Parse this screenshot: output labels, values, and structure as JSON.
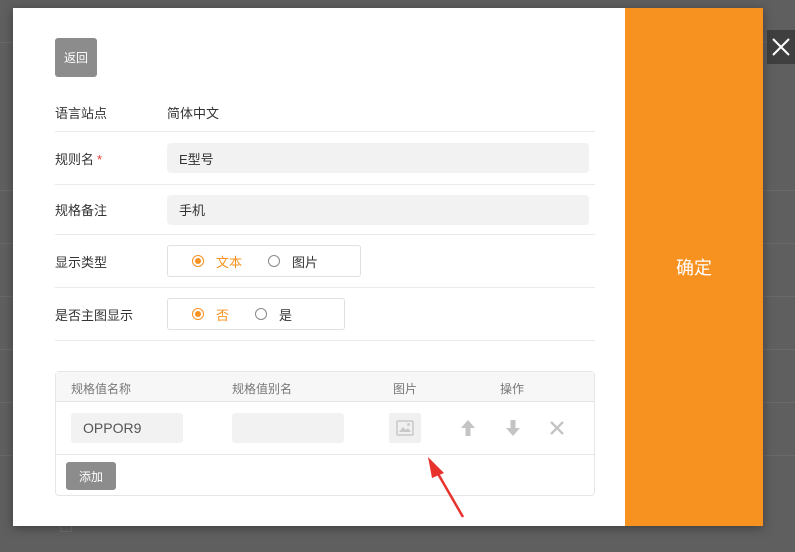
{
  "form": {
    "back_label": "返回",
    "language_label": "语言站点",
    "language_value": "简体中文",
    "rule_label": "规则名",
    "required_mark": "*",
    "rule_value": "E型号",
    "note_label": "规格备注",
    "note_value": "手机",
    "display_type_label": "显示类型",
    "display_type_options": [
      "文本",
      "图片"
    ],
    "display_type_selected": "文本",
    "main_image_label": "是否主图显示",
    "main_image_options": [
      "否",
      "是"
    ],
    "main_image_selected": "否"
  },
  "table": {
    "headers": [
      "规格值名称",
      "规格值别名",
      "图片",
      "操作"
    ],
    "rows": [
      {
        "name": "OPPOR9",
        "alias": ""
      }
    ],
    "add_label": "添加"
  },
  "confirm_label": "确定",
  "colors": {
    "accent": "#f7911f",
    "gray_button": "#8c8c8c",
    "annotation_arrow": "#e8322e"
  },
  "icons": [
    "close-icon",
    "image-placeholder-icon",
    "arrow-up-icon",
    "arrow-down-icon",
    "delete-icon"
  ]
}
